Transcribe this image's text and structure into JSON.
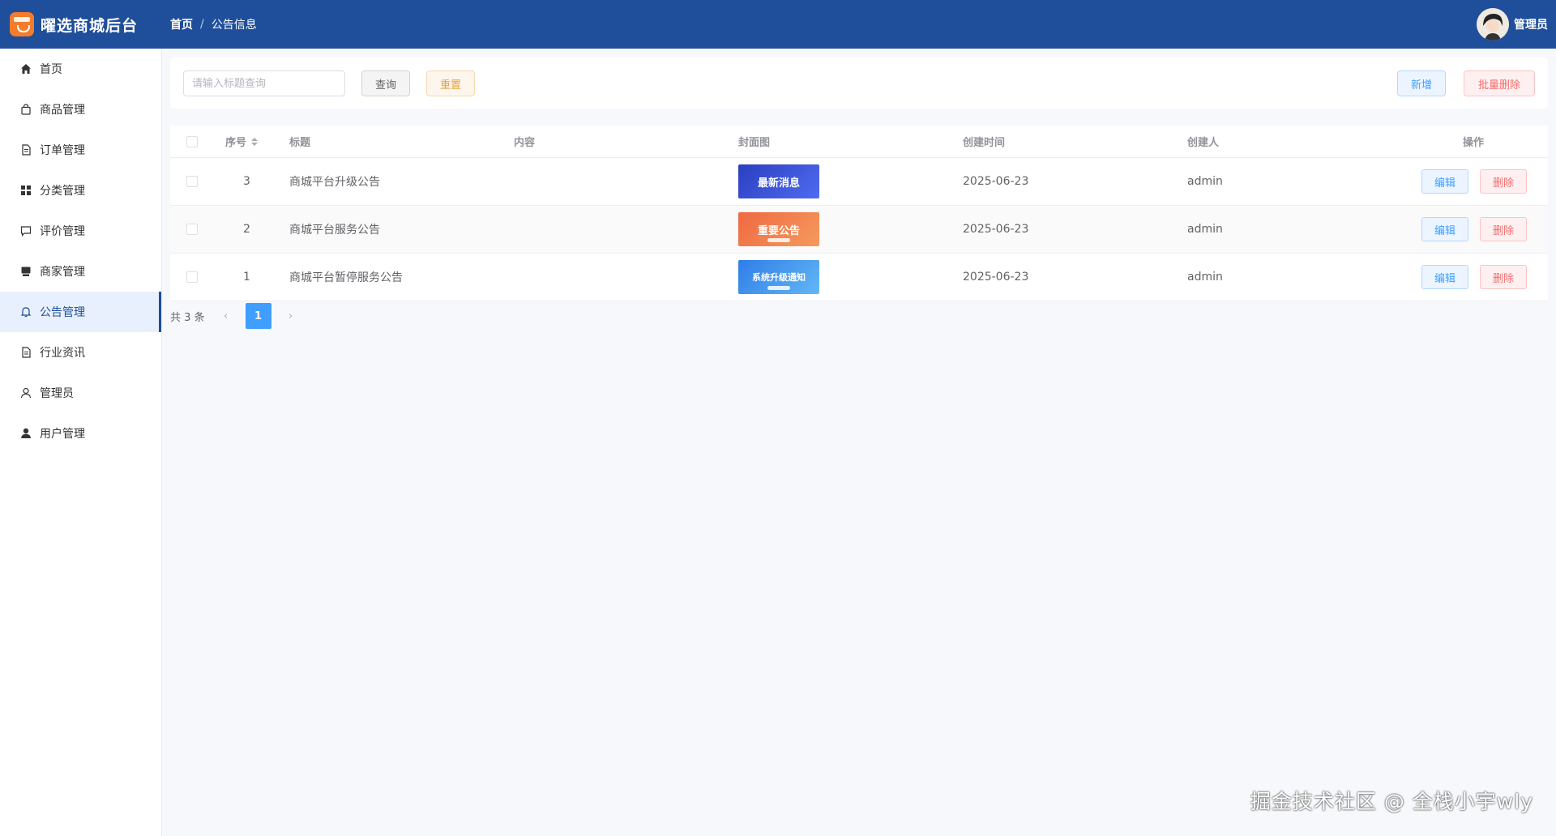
{
  "app": {
    "title": "曜选商城后台"
  },
  "breadcrumb": {
    "home": "首页",
    "separator": "/",
    "current": "公告信息"
  },
  "user": {
    "name": "管理员"
  },
  "sidebar": {
    "items": [
      {
        "label": "首页",
        "icon": "home-icon"
      },
      {
        "label": "商品管理",
        "icon": "shopping-bag-icon"
      },
      {
        "label": "订单管理",
        "icon": "document-icon"
      },
      {
        "label": "分类管理",
        "icon": "grid-icon"
      },
      {
        "label": "评价管理",
        "icon": "comment-icon"
      },
      {
        "label": "商家管理",
        "icon": "store-icon"
      },
      {
        "label": "公告管理",
        "icon": "bell-icon",
        "active": true
      },
      {
        "label": "行业资讯",
        "icon": "document-icon"
      },
      {
        "label": "管理员",
        "icon": "user-outline-icon"
      },
      {
        "label": "用户管理",
        "icon": "user-solid-icon"
      }
    ]
  },
  "search": {
    "placeholder": "请输入标题查询",
    "value": "",
    "query_label": "查询",
    "reset_label": "重置"
  },
  "actions": {
    "add_label": "新增",
    "batch_delete_label": "批量删除"
  },
  "table": {
    "columns": [
      "序号",
      "标题",
      "内容",
      "封面图",
      "创建时间",
      "创建人",
      "操作"
    ],
    "rows": [
      {
        "id": "3",
        "title": "商城平台升级公告",
        "content": "",
        "cover_text": "最新消息",
        "created": "2025-06-23",
        "creator": "admin",
        "cover_color": "#2f4fc9"
      },
      {
        "id": "2",
        "title": "商城平台服务公告",
        "content": "",
        "cover_text": "重要公告",
        "created": "2025-06-23",
        "creator": "admin",
        "cover_color": "#f0714a"
      },
      {
        "id": "1",
        "title": "商城平台暂停服务公告",
        "content": "",
        "cover_text": "系统升级通知",
        "created": "2025-06-23",
        "creator": "admin",
        "cover_color": "#3b8ef0"
      }
    ],
    "edit_label": "编辑",
    "delete_label": "删除"
  },
  "pagination": {
    "total_text": "共 3 条",
    "current_page": "1",
    "prev": "‹",
    "next": "›"
  },
  "watermark": "掘金技术社区 @ 全栈小宇wly"
}
